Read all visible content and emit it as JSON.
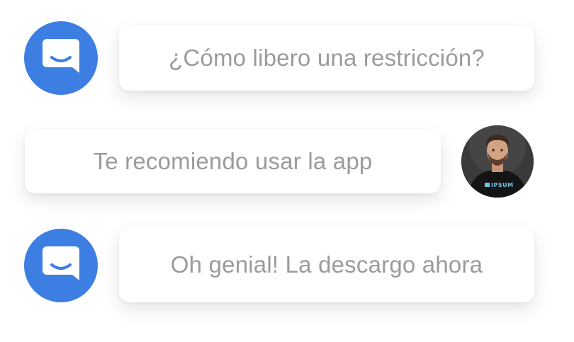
{
  "messages": [
    {
      "sender": "bot",
      "text": "¿Cómo libero una restricción?",
      "avatar_icon": "chat-bubble-smile-icon"
    },
    {
      "sender": "agent",
      "text": "Te recomiendo usar la app",
      "avatar_icon": "person-avatar",
      "shirt_logo": "IPSUM"
    },
    {
      "sender": "bot",
      "text": "Oh genial! La descargo ahora",
      "avatar_icon": "chat-bubble-smile-icon"
    }
  ],
  "colors": {
    "accent": "#3d7ee2",
    "bubble_text": "#9b9b9b",
    "bubble_bg": "#ffffff"
  }
}
